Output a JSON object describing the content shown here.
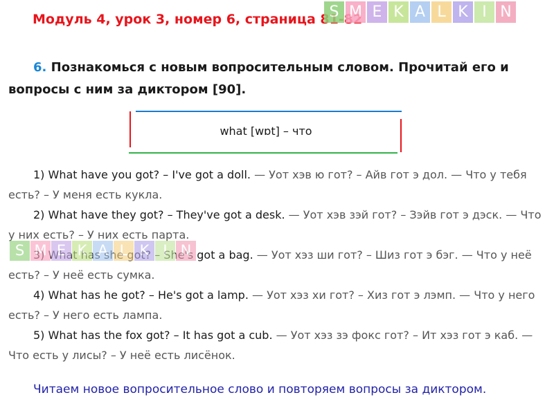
{
  "header": {
    "title_main": "Модуль 4, урок 3, номер 6, страница ",
    "title_pages": "81-82"
  },
  "logo": {
    "letters": [
      "S",
      "M",
      "E",
      "K",
      "A",
      "L",
      "K",
      "I",
      "N"
    ],
    "colors": [
      "#8fd07a",
      "#f9a3c0",
      "#c6a8e8",
      "#bfe28a",
      "#a7c7ef",
      "#f6d48a",
      "#b4a7ea",
      "#c4e6a0",
      "#f2a0b8"
    ]
  },
  "task": {
    "number": "6.",
    "text": " Познакомься с новым вопросительным словом. Прочитай его и вопросы с ним за диктором [90]."
  },
  "vocab": {
    "word": "what [wɒt] – что"
  },
  "items": [
    {
      "en": "1) What have you got? – I've got a doll.",
      "ru": " — Уот хэв ю гот? – Айв гот э дол. — Что у тебя есть? – У меня есть кукла."
    },
    {
      "en": "2) What have they got? – They've got a desk.",
      "ru": " — Уот хэв зэй гот? – Зэйв гот э дэск. — Что у них есть? – У них есть парта."
    },
    {
      "en": "3) What has she got? – She's got a bag.",
      "ru": " — Уот хэз ши гот? – Шиз гот э бэг. — Что у неё есть? – У неё есть сумка."
    },
    {
      "en": "4) What has he got? – He's got a lamp.",
      "ru": " — Уот хэз хи гот? – Хиз гот э лэмп. — Что у него есть? – У него есть лампа."
    },
    {
      "en": "5) What has the fox got? – It has got a cub.",
      "ru": " — Уот хэз зэ фокс гот? – Ит хэз гот э каб. — Что есть у лисы? – У неё есть лисёнок."
    }
  ],
  "footer": {
    "note": "Читаем новое вопросительное слово и повторяем вопросы за диктором."
  }
}
